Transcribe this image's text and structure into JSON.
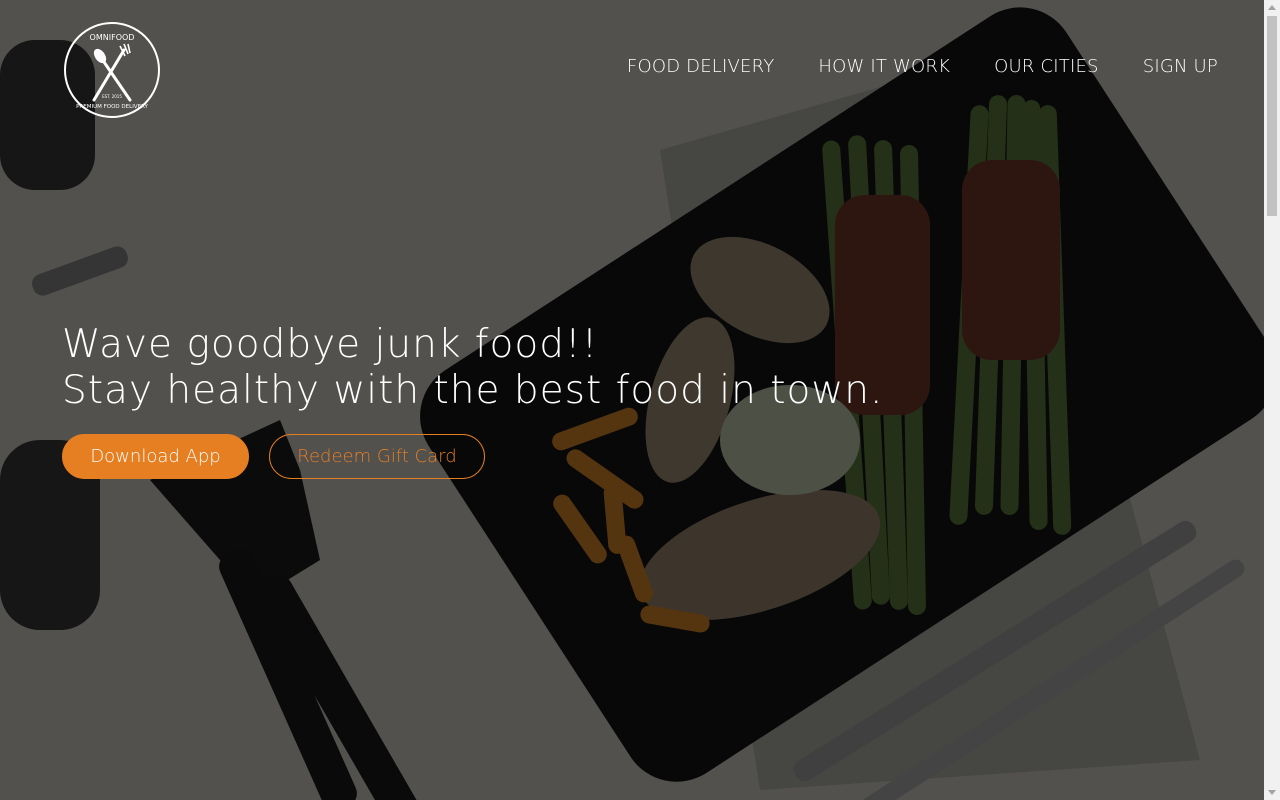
{
  "logo": {
    "brand_top": "OMNIFOOD",
    "brand_bottom": "PREMIUM FOOD DELIVERY",
    "est": "EST. 2015"
  },
  "nav": {
    "items": [
      {
        "label": "FOOD DELIVERY"
      },
      {
        "label": "HOW IT WORK"
      },
      {
        "label": "OUR CITIES"
      },
      {
        "label": "SIGN UP"
      }
    ]
  },
  "hero": {
    "headline_line1": "Wave goodbye junk food!!",
    "headline_line2": "Stay healthy with the best food in town.",
    "primary_button": "Download App",
    "secondary_button": "Redeem Gift Card"
  },
  "colors": {
    "accent": "#e67e22",
    "text": "#ffffff",
    "overlay": "rgba(0,0,0,0.62)"
  }
}
